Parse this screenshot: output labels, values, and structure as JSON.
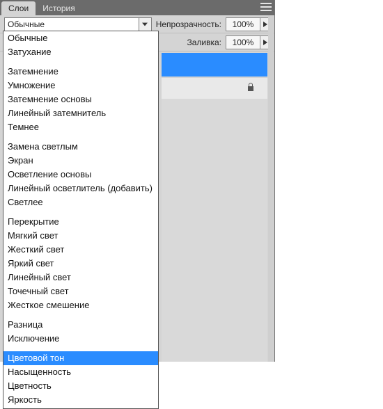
{
  "tabs": {
    "layers": "Слои",
    "history": "История"
  },
  "toolbar": {
    "blend_selected": "Обычные",
    "opacity_label": "Непрозрачность:",
    "opacity_value": "100%",
    "fill_label": "Заливка:",
    "fill_value": "100%"
  },
  "dropdown": {
    "groups": [
      [
        "Обычные",
        "Затухание"
      ],
      [
        "Затемнение",
        "Умножение",
        "Затемнение основы",
        "Линейный затемнитель",
        "Темнее"
      ],
      [
        "Замена светлым",
        "Экран",
        "Осветление основы",
        "Линейный осветлитель (добавить)",
        "Светлее"
      ],
      [
        "Перекрытие",
        "Мягкий свет",
        "Жесткий свет",
        "Яркий свет",
        "Линейный свет",
        "Точечный свет",
        "Жесткое смешение"
      ],
      [
        "Разница",
        "Исключение"
      ],
      [
        "Цветовой тон",
        "Насыщенность",
        "Цветность",
        "Яркость"
      ]
    ],
    "highlight": "Цветовой тон"
  },
  "colors": {
    "highlight": "#2a8cff",
    "panel_bg": "#d4d4d4",
    "tabbar_bg": "#6b6b6b"
  }
}
